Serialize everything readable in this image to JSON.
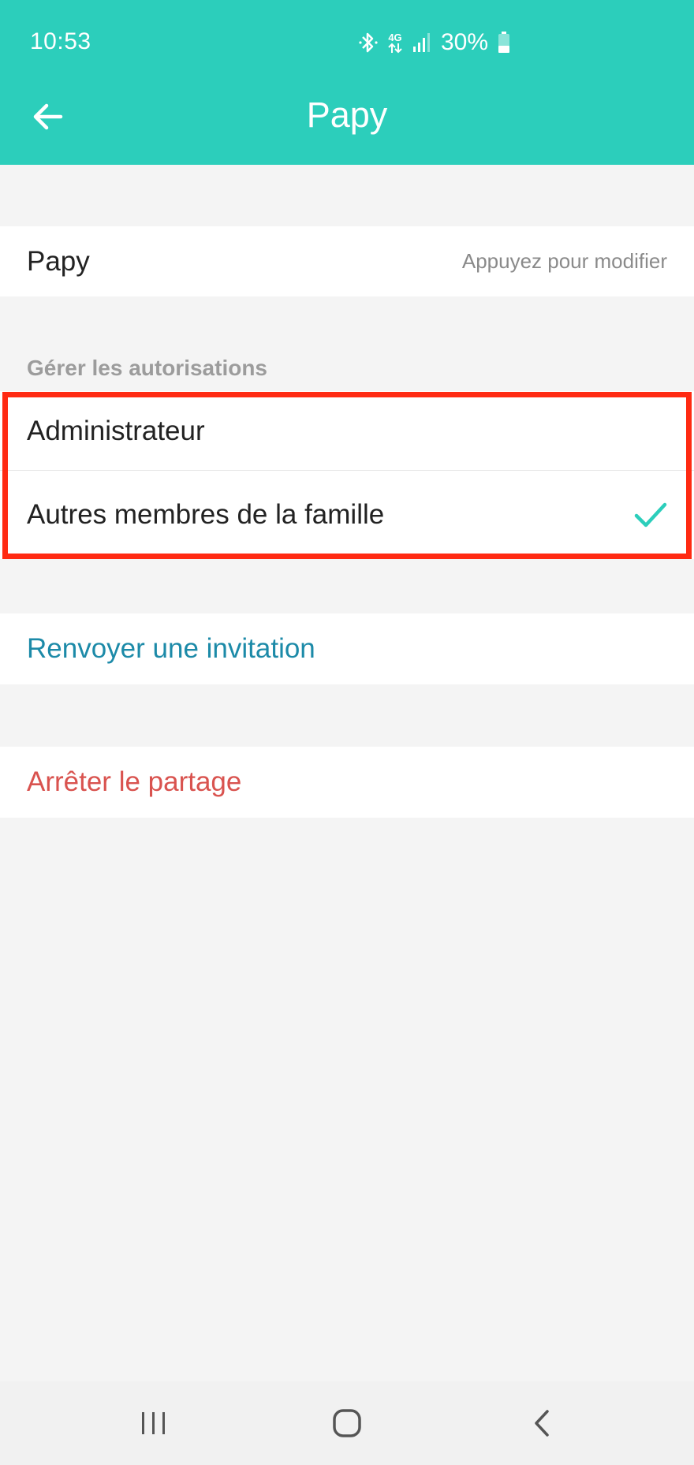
{
  "status_bar": {
    "time": "10:53",
    "network": "4G",
    "battery": "30%"
  },
  "header": {
    "title": "Papy",
    "back_icon": "arrow-left-icon"
  },
  "name_row": {
    "name": "Papy",
    "hint": "Appuyez pour modifier"
  },
  "permissions": {
    "section_title": "Gérer les autorisations",
    "options": [
      {
        "label": "Administrateur",
        "selected": false
      },
      {
        "label": "Autres membres de la famille",
        "selected": true
      }
    ]
  },
  "actions": {
    "resend_invitation": "Renvoyer une invitation",
    "stop_sharing": "Arrêter le partage"
  },
  "colors": {
    "accent": "#2ccebb",
    "link": "#1c8aa8",
    "danger": "#d9534f",
    "highlight": "#ff2a12"
  },
  "nav_bar": {
    "icons": [
      "recent-apps-icon",
      "home-icon",
      "back-icon"
    ]
  }
}
